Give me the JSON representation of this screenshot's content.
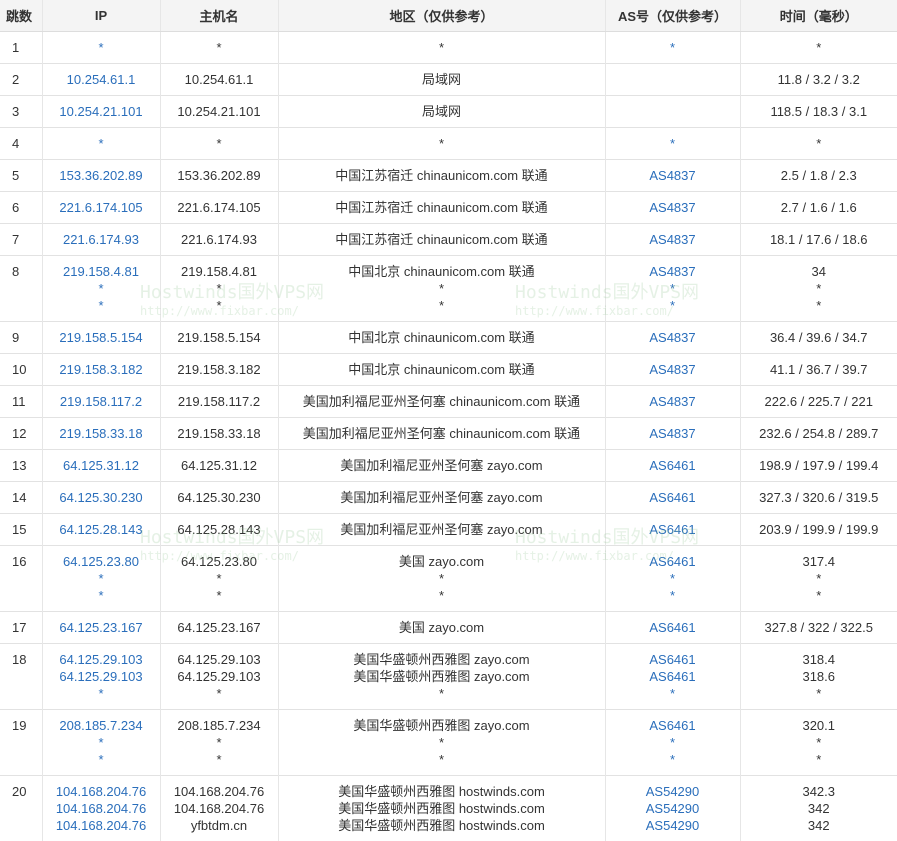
{
  "headers": {
    "hop": "跳数",
    "ip": "IP",
    "host": "主机名",
    "geo": "地区（仅供参考）",
    "as": "AS号（仅供参考）",
    "time": "时间（毫秒）"
  },
  "watermark": {
    "title": "Hostwinds国外VPS网",
    "url": "http://www.fixbar.com/"
  },
  "rows": [
    {
      "hop": "1",
      "ip": [
        "*"
      ],
      "host": [
        "*"
      ],
      "geo": [
        "*"
      ],
      "as": [
        "*"
      ],
      "time": [
        "*"
      ]
    },
    {
      "hop": "2",
      "ip": [
        "10.254.61.1"
      ],
      "host": [
        "10.254.61.1"
      ],
      "geo": [
        "局域网"
      ],
      "as": [
        ""
      ],
      "time": [
        "11.8 / 3.2 / 3.2"
      ]
    },
    {
      "hop": "3",
      "ip": [
        "10.254.21.101"
      ],
      "host": [
        "10.254.21.101"
      ],
      "geo": [
        "局域网"
      ],
      "as": [
        ""
      ],
      "time": [
        "118.5 / 18.3 / 3.1"
      ]
    },
    {
      "hop": "4",
      "ip": [
        "*"
      ],
      "host": [
        "*"
      ],
      "geo": [
        "*"
      ],
      "as": [
        "*"
      ],
      "time": [
        "*"
      ]
    },
    {
      "hop": "5",
      "ip": [
        "153.36.202.89"
      ],
      "host": [
        "153.36.202.89"
      ],
      "geo": [
        "中国江苏宿迁 chinaunicom.com 联通"
      ],
      "as": [
        "AS4837"
      ],
      "time": [
        "2.5 / 1.8 / 2.3"
      ]
    },
    {
      "hop": "6",
      "ip": [
        "221.6.174.105"
      ],
      "host": [
        "221.6.174.105"
      ],
      "geo": [
        "中国江苏宿迁 chinaunicom.com 联通"
      ],
      "as": [
        "AS4837"
      ],
      "time": [
        "2.7 / 1.6 / 1.6"
      ]
    },
    {
      "hop": "7",
      "ip": [
        "221.6.174.93"
      ],
      "host": [
        "221.6.174.93"
      ],
      "geo": [
        "中国江苏宿迁 chinaunicom.com 联通"
      ],
      "as": [
        "AS4837"
      ],
      "time": [
        "18.1 / 17.6 / 18.6"
      ]
    },
    {
      "hop": "8",
      "ip": [
        "219.158.4.81",
        "*",
        "*"
      ],
      "host": [
        "219.158.4.81",
        "*",
        "*"
      ],
      "geo": [
        "中国北京 chinaunicom.com 联通",
        "*",
        "*"
      ],
      "as": [
        "AS4837",
        "*",
        "*"
      ],
      "time": [
        "34",
        "*",
        "*"
      ]
    },
    {
      "hop": "9",
      "ip": [
        "219.158.5.154"
      ],
      "host": [
        "219.158.5.154"
      ],
      "geo": [
        "中国北京 chinaunicom.com 联通"
      ],
      "as": [
        "AS4837"
      ],
      "time": [
        "36.4 / 39.6 / 34.7"
      ]
    },
    {
      "hop": "10",
      "ip": [
        "219.158.3.182"
      ],
      "host": [
        "219.158.3.182"
      ],
      "geo": [
        "中国北京 chinaunicom.com 联通"
      ],
      "as": [
        "AS4837"
      ],
      "time": [
        "41.1 / 36.7 / 39.7"
      ]
    },
    {
      "hop": "11",
      "ip": [
        "219.158.117.2"
      ],
      "host": [
        "219.158.117.2"
      ],
      "geo": [
        "美国加利福尼亚州圣何塞 chinaunicom.com 联通"
      ],
      "as": [
        "AS4837"
      ],
      "time": [
        "222.6 / 225.7 / 221"
      ]
    },
    {
      "hop": "12",
      "ip": [
        "219.158.33.18"
      ],
      "host": [
        "219.158.33.18"
      ],
      "geo": [
        "美国加利福尼亚州圣何塞 chinaunicom.com 联通"
      ],
      "as": [
        "AS4837"
      ],
      "time": [
        "232.6 / 254.8 / 289.7"
      ]
    },
    {
      "hop": "13",
      "ip": [
        "64.125.31.12"
      ],
      "host": [
        "64.125.31.12"
      ],
      "geo": [
        "美国加利福尼亚州圣何塞 zayo.com"
      ],
      "as": [
        "AS6461"
      ],
      "time": [
        "198.9 / 197.9 / 199.4"
      ]
    },
    {
      "hop": "14",
      "ip": [
        "64.125.30.230"
      ],
      "host": [
        "64.125.30.230"
      ],
      "geo": [
        "美国加利福尼亚州圣何塞 zayo.com"
      ],
      "as": [
        "AS6461"
      ],
      "time": [
        "327.3 / 320.6 / 319.5"
      ]
    },
    {
      "hop": "15",
      "ip": [
        "64.125.28.143"
      ],
      "host": [
        "64.125.28.143"
      ],
      "geo": [
        "美国加利福尼亚州圣何塞 zayo.com"
      ],
      "as": [
        "AS6461"
      ],
      "time": [
        "203.9 / 199.9 / 199.9"
      ]
    },
    {
      "hop": "16",
      "ip": [
        "64.125.23.80",
        "*",
        "*"
      ],
      "host": [
        "64.125.23.80",
        "*",
        "*"
      ],
      "geo": [
        "美国 zayo.com",
        "*",
        "*"
      ],
      "as": [
        "AS6461",
        "*",
        "*"
      ],
      "time": [
        "317.4",
        "*",
        "*"
      ]
    },
    {
      "hop": "17",
      "ip": [
        "64.125.23.167"
      ],
      "host": [
        "64.125.23.167"
      ],
      "geo": [
        "美国 zayo.com"
      ],
      "as": [
        "AS6461"
      ],
      "time": [
        "327.8 / 322 / 322.5"
      ]
    },
    {
      "hop": "18",
      "ip": [
        "64.125.29.103",
        "64.125.29.103",
        "*"
      ],
      "host": [
        "64.125.29.103",
        "64.125.29.103",
        "*"
      ],
      "geo": [
        "美国华盛顿州西雅图 zayo.com",
        "美国华盛顿州西雅图 zayo.com",
        "*"
      ],
      "as": [
        "AS6461",
        "AS6461",
        "*"
      ],
      "time": [
        "318.4",
        "318.6",
        "*"
      ]
    },
    {
      "hop": "19",
      "ip": [
        "208.185.7.234",
        "*",
        "*"
      ],
      "host": [
        "208.185.7.234",
        "*",
        "*"
      ],
      "geo": [
        "美国华盛顿州西雅图 zayo.com",
        "*",
        "*"
      ],
      "as": [
        "AS6461",
        "*",
        "*"
      ],
      "time": [
        "320.1",
        "*",
        "*"
      ]
    },
    {
      "hop": "20",
      "ip": [
        "104.168.204.76",
        "104.168.204.76",
        "104.168.204.76"
      ],
      "host": [
        "104.168.204.76",
        "104.168.204.76",
        "yfbtdm.cn"
      ],
      "geo": [
        "美国华盛顿州西雅图 hostwinds.com",
        "美国华盛顿州西雅图 hostwinds.com",
        "美国华盛顿州西雅图 hostwinds.com"
      ],
      "as": [
        "AS54290",
        "AS54290",
        "AS54290"
      ],
      "time": [
        "342.3",
        "342",
        "342"
      ]
    }
  ]
}
